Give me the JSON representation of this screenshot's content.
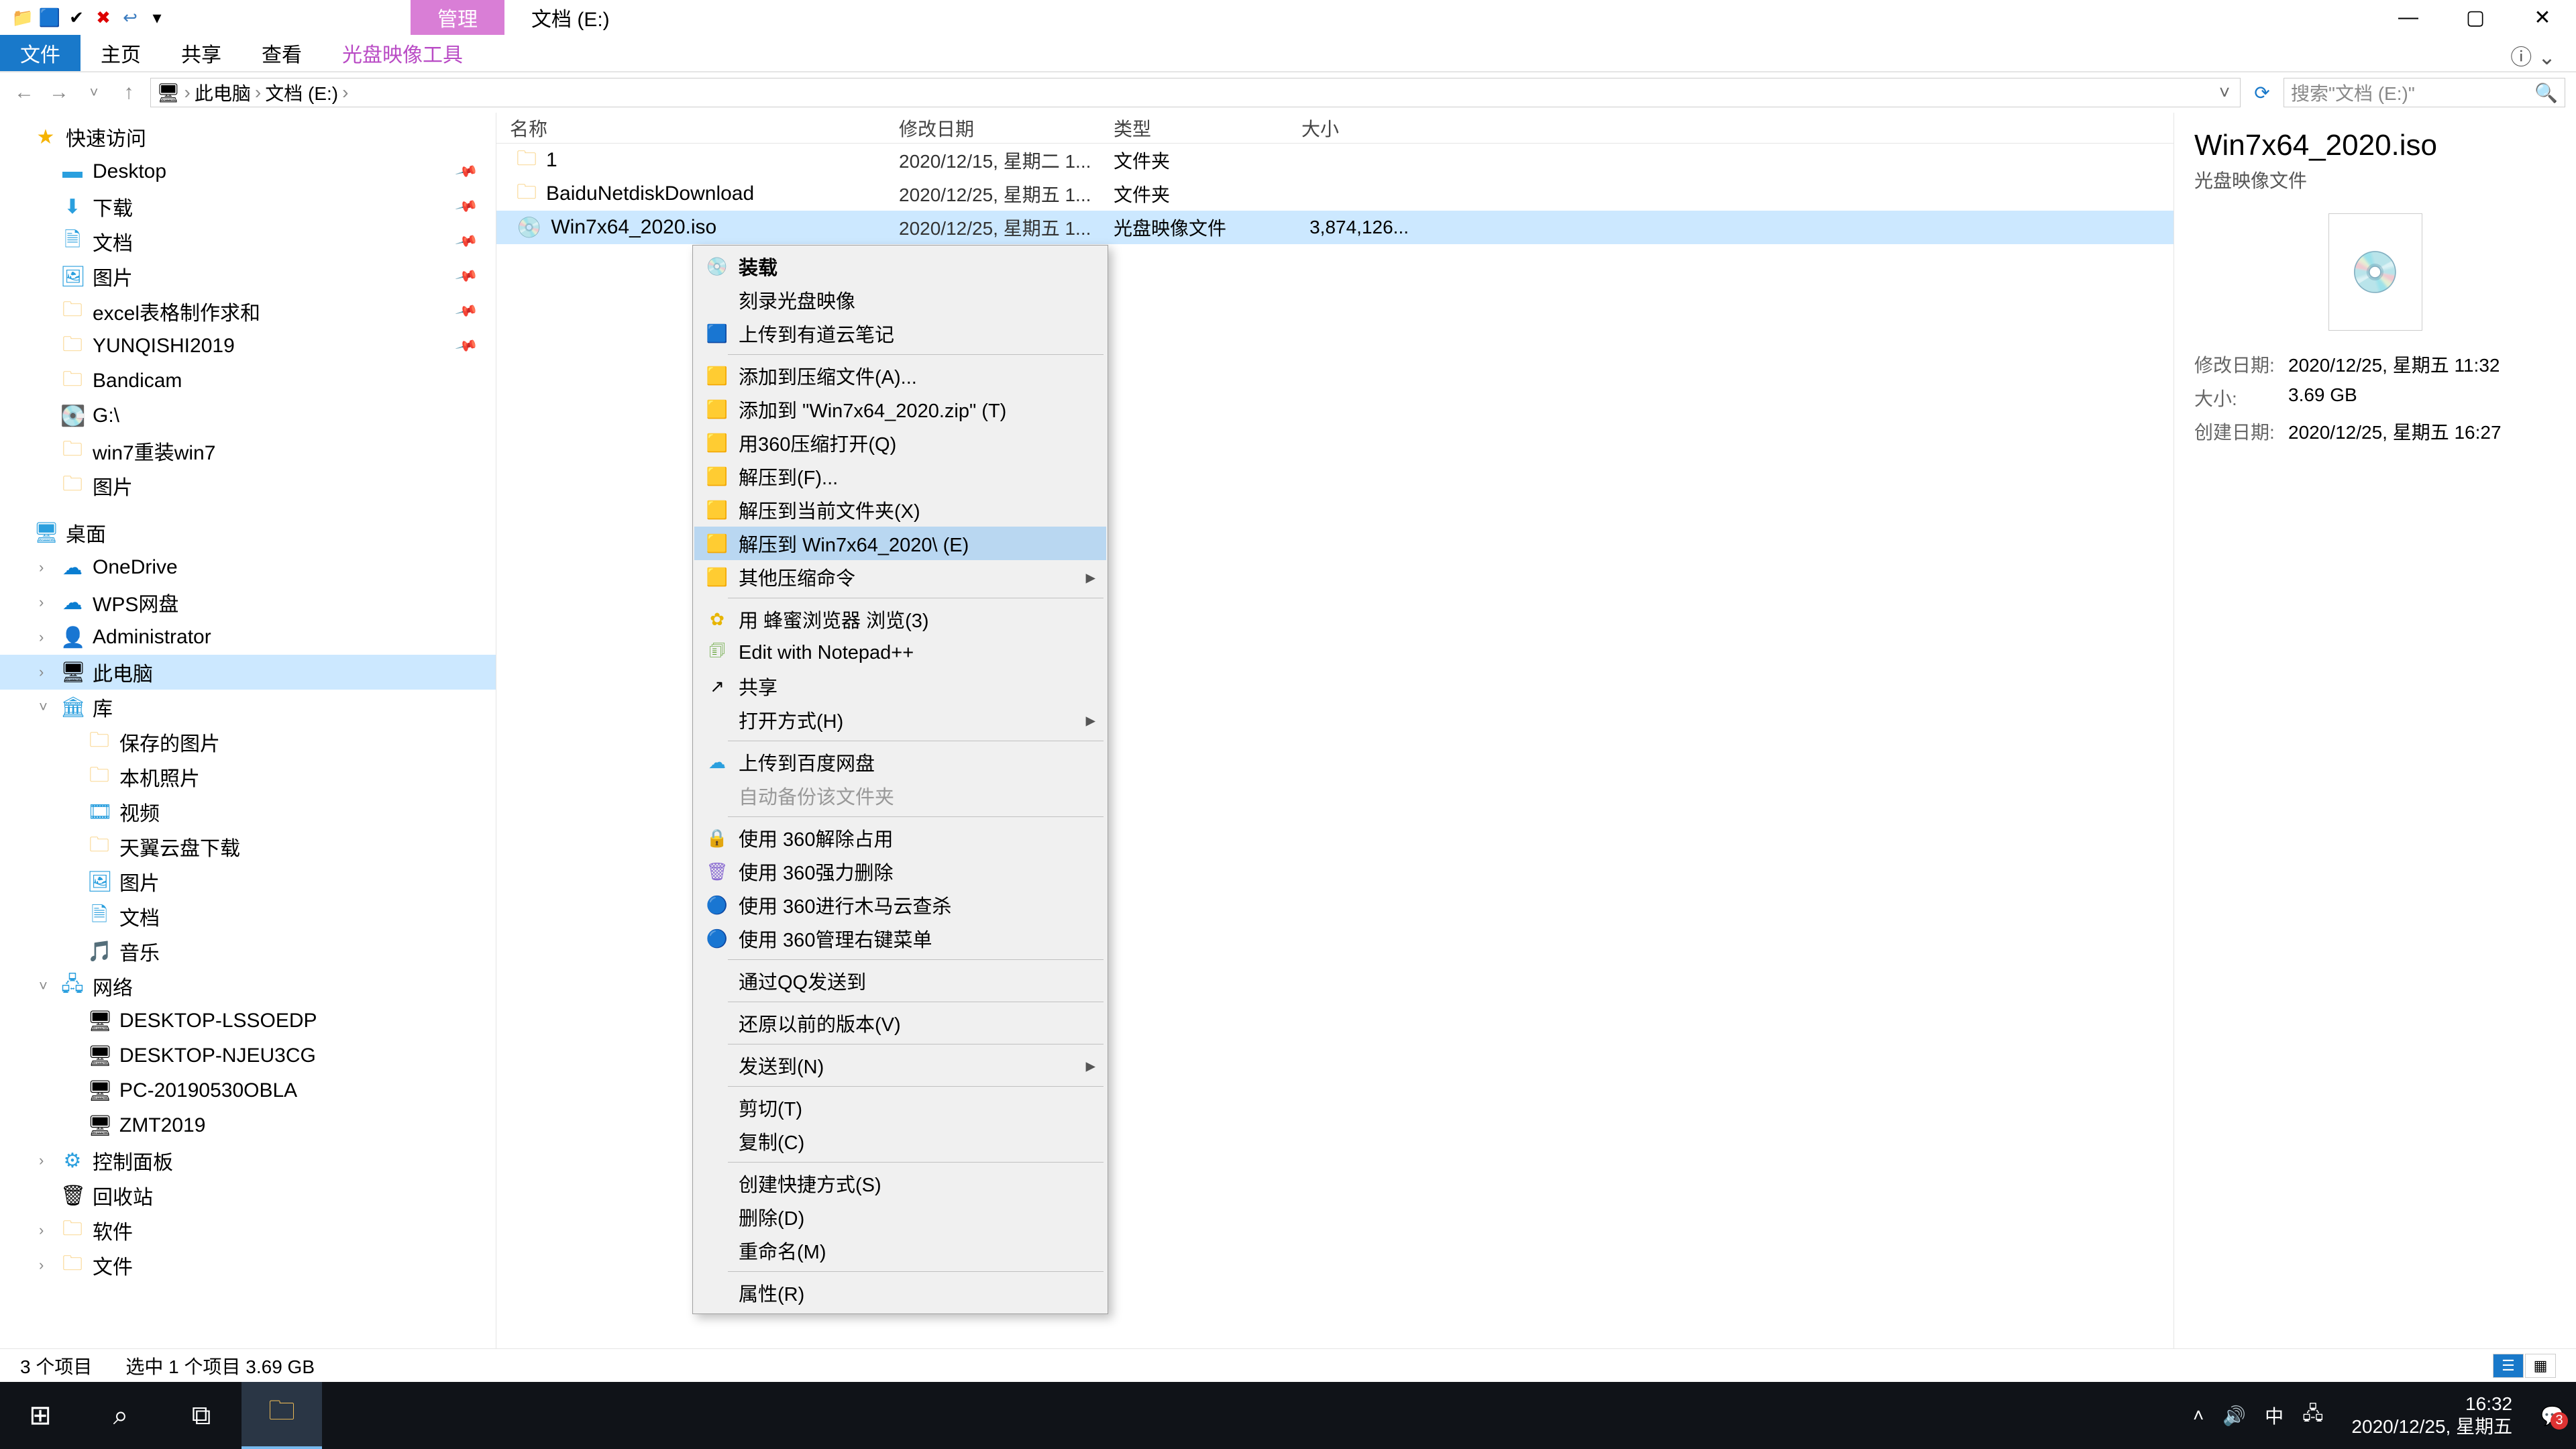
{
  "title_tab_manage": "管理",
  "title_location": "文档 (E:)",
  "ribbon": {
    "file": "文件",
    "home": "主页",
    "share": "共享",
    "view": "查看",
    "iso_tools": "光盘映像工具"
  },
  "breadcrumb": {
    "this_pc": "此电脑",
    "drive": "文档 (E:)"
  },
  "search_placeholder": "搜索\"文档 (E:)\"",
  "tree": {
    "quick": "快速访问",
    "desktop": "Desktop",
    "downloads": "下载",
    "documents": "文档",
    "pictures": "图片",
    "excel": "excel表格制作求和",
    "yunqishi": "YUNQISHI2019",
    "bandicam": "Bandicam",
    "g": "G:\\",
    "win7re": "win7重装win7",
    "pics2": "图片",
    "desktop_cn": "桌面",
    "onedrive": "OneDrive",
    "wps": "WPS网盘",
    "admin": "Administrator",
    "thispc": "此电脑",
    "lib": "库",
    "saved": "保存的图片",
    "camera": "本机照片",
    "video": "视频",
    "tianyi": "天翼云盘下载",
    "pics3": "图片",
    "docs2": "文档",
    "music": "音乐",
    "network": "网络",
    "d1": "DESKTOP-LSSOEDP",
    "d2": "DESKTOP-NJEU3CG",
    "d3": "PC-20190530OBLA",
    "d4": "ZMT2019",
    "ctrl": "控制面板",
    "recycle": "回收站",
    "soft": "软件",
    "files": "文件"
  },
  "cols": {
    "name": "名称",
    "date": "修改日期",
    "type": "类型",
    "size": "大小"
  },
  "rows": [
    {
      "name": "1",
      "date": "2020/12/15, 星期二 1...",
      "type": "文件夹",
      "size": ""
    },
    {
      "name": "BaiduNetdiskDownload",
      "date": "2020/12/25, 星期五 1...",
      "type": "文件夹",
      "size": ""
    },
    {
      "name": "Win7x64_2020.iso",
      "date": "2020/12/25, 星期五 1...",
      "type": "光盘映像文件",
      "size": "3,874,126..."
    }
  ],
  "ctx": {
    "mount": "装载",
    "burn": "刻录光盘映像",
    "youdao": "上传到有道云笔记",
    "add_arc": "添加到压缩文件(A)...",
    "add_zip": "添加到 \"Win7x64_2020.zip\" (T)",
    "open360": "用360压缩打开(Q)",
    "extract_to": "解压到(F)...",
    "extract_here": "解压到当前文件夹(X)",
    "extract_named": "解压到 Win7x64_2020\\ (E)",
    "other_arc": "其他压缩命令",
    "fengmi": "用 蜂蜜浏览器 浏览(3)",
    "npp": "Edit with Notepad++",
    "share": "共享",
    "openwith": "打开方式(H)",
    "baidu": "上传到百度网盘",
    "autobak": "自动备份该文件夹",
    "u360_1": "使用 360解除占用",
    "u360_2": "使用 360强力删除",
    "u360_3": "使用 360进行木马云查杀",
    "u360_4": "使用 360管理右键菜单",
    "qq": "通过QQ发送到",
    "restore": "还原以前的版本(V)",
    "sendto": "发送到(N)",
    "cut": "剪切(T)",
    "copy": "复制(C)",
    "shortcut": "创建快捷方式(S)",
    "delete": "删除(D)",
    "rename": "重命名(M)",
    "props": "属性(R)"
  },
  "preview": {
    "title": "Win7x64_2020.iso",
    "sub": "光盘映像文件",
    "mdate_k": "修改日期:",
    "mdate_v": "2020/12/25, 星期五 11:32",
    "size_k": "大小:",
    "size_v": "3.69 GB",
    "cdate_k": "创建日期:",
    "cdate_v": "2020/12/25, 星期五 16:27"
  },
  "status": {
    "count": "3 个项目",
    "sel": "选中 1 个项目  3.69 GB"
  },
  "taskbar": {
    "time": "16:32",
    "date": "2020/12/25, 星期五",
    "ime": "中",
    "badge": "3"
  }
}
